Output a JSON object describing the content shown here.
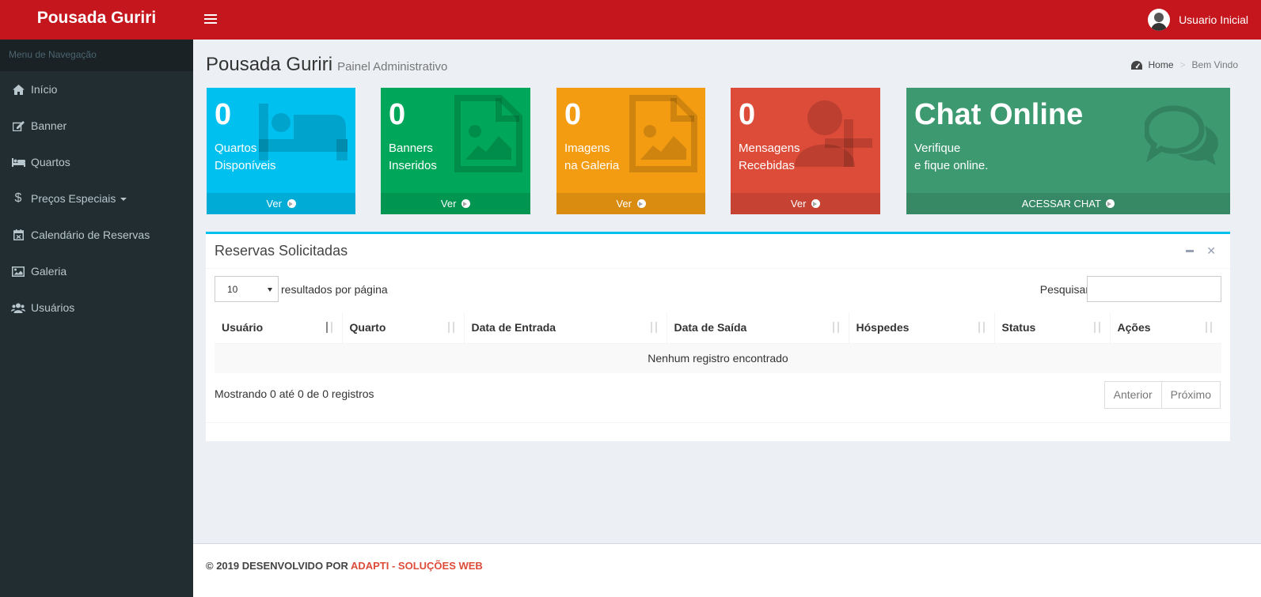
{
  "header": {
    "logo": "Pousada Guriri",
    "user_name": "Usuario Inicial"
  },
  "sidebar": {
    "heading": "Menu de Navegação",
    "items": [
      {
        "label": "Início",
        "icon": "home-icon"
      },
      {
        "label": "Banner",
        "icon": "edit-icon"
      },
      {
        "label": "Quartos",
        "icon": "bed-icon"
      },
      {
        "label": "Preços Especiais",
        "icon": "dollar-icon"
      },
      {
        "label": "Calendário de Reservas",
        "icon": "calendar-icon"
      },
      {
        "label": "Galeria",
        "icon": "image-icon"
      },
      {
        "label": "Usuários",
        "icon": "users-icon"
      }
    ]
  },
  "page": {
    "title": "Pousada Guriri",
    "subtitle": "Painel Administrativo",
    "breadcrumb": {
      "home": "Home",
      "current": "Bem Vindo"
    }
  },
  "boxes": [
    {
      "count": "0",
      "line1": "Quartos",
      "line2": "Disponíveis",
      "link": "Ver",
      "color": "#00c0ef",
      "icon": "bed-icon"
    },
    {
      "count": "0",
      "line1": "Banners",
      "line2": "Inseridos",
      "link": "Ver",
      "color": "#00a65a",
      "icon": "file-image-icon"
    },
    {
      "count": "0",
      "line1": "Imagens",
      "line2": "na Galeria",
      "link": "Ver",
      "color": "#f39c12",
      "icon": "file-image-icon"
    },
    {
      "count": "0",
      "line1": "Mensagens",
      "line2": "Recebidas",
      "link": "Ver",
      "color": "#dd4b39",
      "icon": "user-plus-icon"
    }
  ],
  "chat_box": {
    "title": "Chat Online",
    "line1": "Verifique",
    "line2": "e fique online.",
    "link": "ACESSAR CHAT",
    "color": "#3d9970",
    "icon": "comments-icon"
  },
  "panel": {
    "title": "Reservas Solicitadas",
    "length_value": "10",
    "length_label": "resultados por página",
    "search_label": "Pesquisar",
    "search_value": "",
    "columns": [
      "Usuário",
      "Quarto",
      "Data de Entrada",
      "Data de Saída",
      "Hóspedes",
      "Status",
      "Ações"
    ],
    "empty_message": "Nenhum registro encontrado",
    "info": "Mostrando 0 até 0 de 0 registros",
    "prev": "Anterior",
    "next": "Próximo"
  },
  "footer": {
    "text": "© 2019 DESENVOLVIDO POR ",
    "brand": "ADAPTI - SOLUÇÕES WEB"
  }
}
